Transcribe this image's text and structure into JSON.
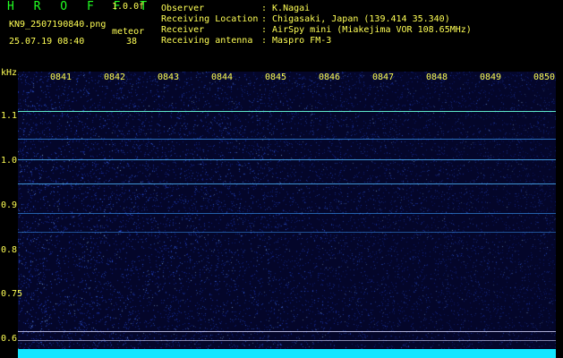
{
  "header": {
    "app_name": "H R O F F T",
    "version": "1.0.0f",
    "filename": "KN9_2507190840.png",
    "mode": "meteor",
    "datetime": "25.07.19 08:40",
    "count": "38",
    "info_labels": [
      "Observer",
      "Receiving Location",
      "Receiver",
      "Receiving antenna"
    ],
    "info_values": [
      ": K.Nagai",
      ": Chigasaki, Japan (139.414 35.340)",
      ": AirSpy mini (Miakejima VOR 108.65MHz)",
      ": Maspro FM-3"
    ]
  },
  "axes": {
    "unit": "kHz",
    "x_ticks": [
      "0841",
      "0842",
      "0843",
      "0844",
      "0845",
      "0846",
      "0847",
      "0848",
      "0849",
      "0850"
    ],
    "y_ticks": [
      "1.1",
      "1.0",
      "0.9",
      "0.8",
      "0.75",
      "0.6"
    ]
  },
  "colors": {
    "background": "#000000",
    "label": "#ffff55",
    "title": "#22ff22",
    "plot_bg": "#04062a",
    "noise": "#3a6bff",
    "band_bottom": "#14e6ff"
  }
}
